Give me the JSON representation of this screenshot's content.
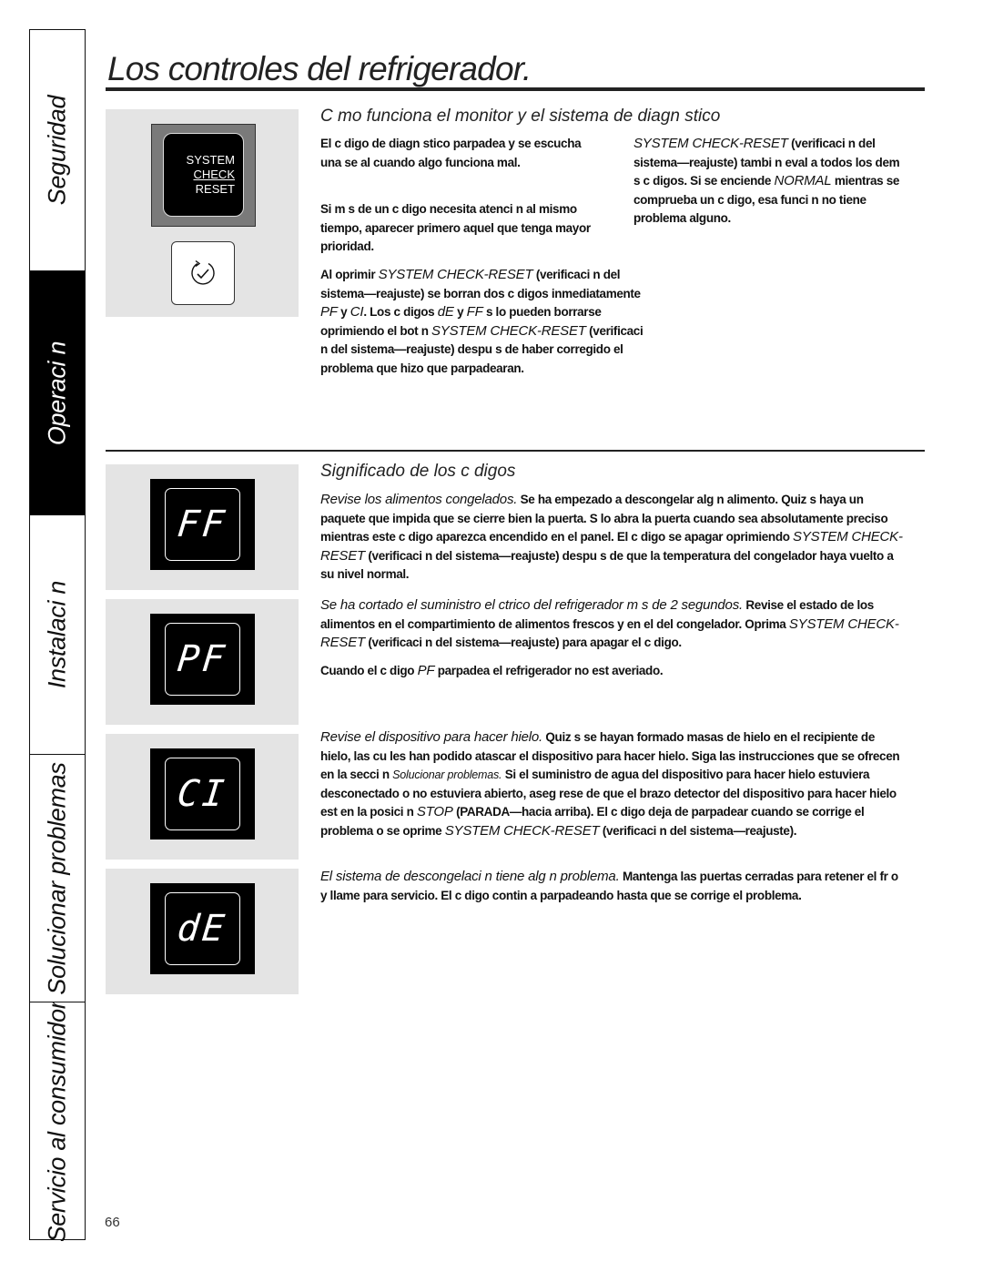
{
  "side_tabs": [
    {
      "label": "Seguridad",
      "active": false
    },
    {
      "label": "Operaci n",
      "active": true
    },
    {
      "label": "Instalaci n",
      "active": false
    },
    {
      "label": "Solucionar problemas",
      "active": false
    },
    {
      "label": "Servicio al consumidor",
      "active": false
    }
  ],
  "page": {
    "title": "Los controles del refrigerador.",
    "number": "66"
  },
  "button_image": {
    "line1": "SYSTEM",
    "line2": "CHECK",
    "line3": "RESET",
    "icon": "refresh-check-icon"
  },
  "section1": {
    "heading": "C mo funciona el monitor y el sistema de diagn stico",
    "col1": {
      "p1": "El c digo de diagn stico parpadea y se escucha una se al cuando algo funciona mal.",
      "p2": "Si m s de un c digo necesita atenci n al mismo tiempo, aparecer primero aquel que tenga mayor prioridad.",
      "p3_a": "Al oprimir ",
      "p3_b": "SYSTEM CHECK-RESET",
      "p3_c": " (verificaci n del sistema—reajuste) se borran dos c digos inmediatamente ",
      "p3_d": "PF",
      "p3_e": " y ",
      "p3_f": "CI",
      "p3_g": ". Los c digos ",
      "p3_h": "dE",
      "p3_i": " y ",
      "p3_j": "FF",
      "p3_k": " s lo pueden borrarse oprimiendo el bot n ",
      "p3_l": "SYSTEM CHECK-RESET",
      "p3_m": " (verificaci n del sistema—reajuste) despu s de haber corregido el problema que hizo que parpadearan."
    },
    "col2": {
      "p1_a": "SYSTEM CHECK-RESET",
      "p1_b": " (verificaci n del sistema—reajuste) tambi n eval a todos los dem s c digos. Si se enciende ",
      "p1_c": "NORMAL",
      "p1_d": " mientras se comprueba un c digo, esa funci n no tiene problema alguno."
    }
  },
  "section2": {
    "heading": "Significado de los c digos",
    "codes": [
      {
        "code": "FF",
        "lead": "Revise los alimentos congelados.",
        "text_a": " Se ha empezado a descongelar alg n alimento. Quiz s haya un paquete que impida que se cierre bien la puerta. S lo abra la puerta cuando sea absolutamente preciso mientras este c digo aparezca encendido en el panel. El c digo se apagar oprimiendo ",
        "text_b": "SYSTEM CHECK-RESET",
        "text_c": " (verificaci n del sistema—reajuste) despu s de que la temperatura del congelador haya vuelto a su nivel normal."
      },
      {
        "code": "PF",
        "lead": "Se ha cortado el suministro el ctrico del refrigerador m s de 2 segundos.",
        "text_a": " Revise el estado de los alimentos en el compartimiento de alimentos frescos y en el del congelador. Oprima ",
        "text_b": "SYSTEM CHECK-RESET",
        "text_c": " (verificaci n del sistema—reajuste) para apagar el c digo.",
        "note_a": "Cuando el c digo ",
        "note_b": "PF",
        "note_c": " parpadea el refrigerador no est averiado."
      },
      {
        "code": "CI",
        "lead": "Revise el dispositivo para hacer hielo.",
        "text_a": " Quiz s se hayan formado masas de hielo en el recipiente de hielo, las cu les han podido atascar el dispositivo para hacer hielo. Siga las instrucciones que se ofrecen en la secci n ",
        "text_b": "Solucionar problemas.",
        "text_c": " Si el suministro de agua del dispositivo para hacer hielo estuviera desconectado o no estuviera abierto, aseg rese de que el brazo detector del dispositivo para hacer hielo est en la posici n ",
        "text_d": "STOP",
        "text_e": " (PARADA—hacia arriba). El c digo deja de parpadear cuando se corrige el problema o se oprime ",
        "text_f": "SYSTEM CHECK-RESET",
        "text_g": " (verificaci n del sistema—reajuste)."
      },
      {
        "code": "dE",
        "lead": "El sistema de descongelaci n tiene alg n problema.",
        "text_a": " Mantenga las puertas cerradas para retener el fr o y llame para servicio. El c digo contin a parpadeando hasta que se corrige el problema."
      }
    ]
  }
}
